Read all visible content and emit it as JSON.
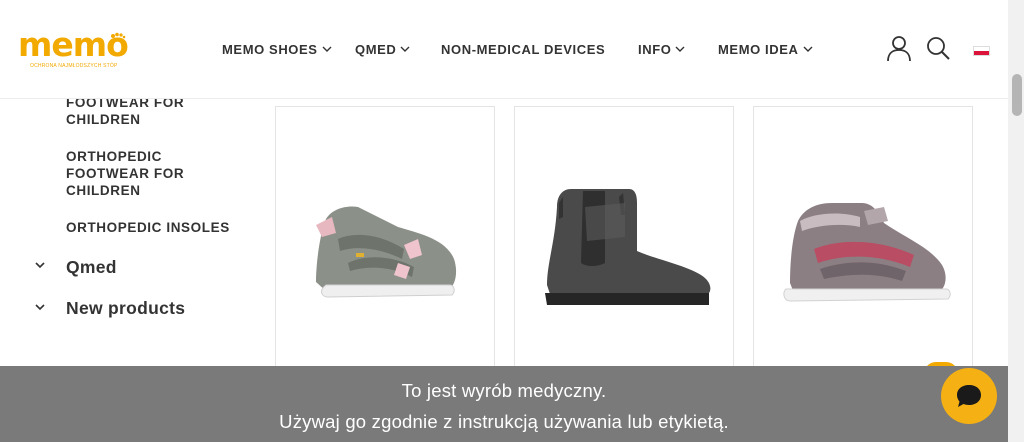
{
  "header": {
    "logo_text": "memo",
    "logo_tagline": "OCHRONA NAJMŁODSZYCH STÓP",
    "nav": [
      {
        "label": "MEMO SHOES",
        "has_dropdown": true
      },
      {
        "label": "QMED",
        "has_dropdown": true
      },
      {
        "label": "NON-MEDICAL DEVICES",
        "has_dropdown": false
      },
      {
        "label": "INFO",
        "has_dropdown": true
      },
      {
        "label": "MEMO IDEA",
        "has_dropdown": true
      }
    ],
    "icons": [
      "user-icon",
      "search-icon",
      "flag-pl-icon"
    ]
  },
  "sidebar": {
    "sub_items": [
      {
        "label": "FOOTWEAR FOR CHILDREN"
      },
      {
        "label": "ORTHOPEDIC FOOTWEAR FOR CHILDREN"
      },
      {
        "label": "ORTHOPEDIC INSOLES"
      }
    ],
    "categories": [
      {
        "label": "Qmed"
      },
      {
        "label": "New products"
      }
    ]
  },
  "products": [
    {
      "image": "grey-sandal-pink-bow"
    },
    {
      "image": "dark-grey-chelsea-boot"
    },
    {
      "image": "grey-pink-velcro-sneaker"
    }
  ],
  "notice": {
    "line1": "To jest wyrób medyczny.",
    "line2": "Używaj go zgodnie z instrukcją używania lub etykietą."
  },
  "colors": {
    "brand": "#f2a900",
    "banner": "#7a7a7a",
    "text": "#333333"
  }
}
